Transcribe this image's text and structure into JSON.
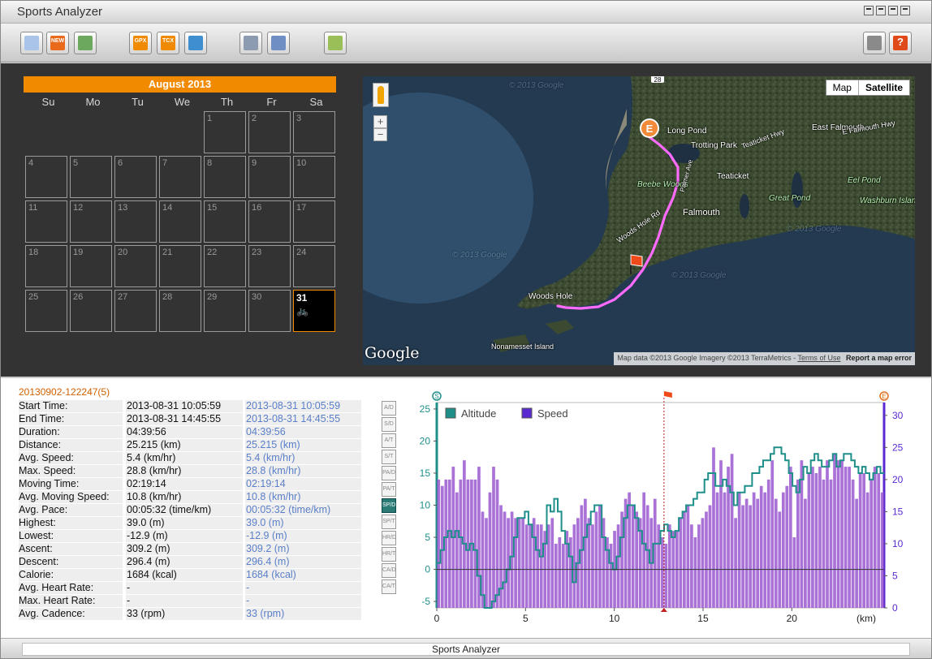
{
  "window": {
    "title": "Sports Analyzer"
  },
  "toolbar": {
    "buttons": [
      {
        "name": "import-button",
        "color": "#a9c4e8",
        "text": ""
      },
      {
        "name": "new-button",
        "color": "#e96a1a",
        "text": "NEW"
      },
      {
        "name": "list-view-button",
        "color": "#6ca85e",
        "text": ""
      },
      {
        "name": "export-gpx-button",
        "color": "#f08a00",
        "text": "GPX"
      },
      {
        "name": "export-tcx-button",
        "color": "#f08a00",
        "text": "TCX"
      },
      {
        "name": "google-earth-button",
        "color": "#3f8fd0",
        "text": ""
      },
      {
        "name": "print-button",
        "color": "#8c9bb0",
        "text": ""
      },
      {
        "name": "database-button",
        "color": "#6f8fc4",
        "text": ""
      },
      {
        "name": "device-sync-button",
        "color": "#9bbf58",
        "text": ""
      },
      {
        "name": "settings-button",
        "color": "#8a8a8a",
        "text": ""
      },
      {
        "name": "help-button",
        "color": "#e04a1a",
        "text": "?"
      }
    ]
  },
  "calendar": {
    "month_label": "August 2013",
    "weekdays": [
      "Su",
      "Mo",
      "Tu",
      "We",
      "Th",
      "Fr",
      "Sa"
    ],
    "first_weekday_index": 4,
    "days": [
      "1",
      "2",
      "3",
      "4",
      "5",
      "6",
      "7",
      "8",
      "9",
      "10",
      "11",
      "12",
      "13",
      "14",
      "15",
      "16",
      "17",
      "18",
      "19",
      "20",
      "21",
      "22",
      "23",
      "24",
      "25",
      "26",
      "27",
      "28",
      "29",
      "30",
      "31"
    ],
    "selected_day": "31",
    "activity_icon": "bicycle-icon"
  },
  "map": {
    "map_type_options": [
      "Map",
      "Satellite"
    ],
    "selected_map_type": "Satellite",
    "labels": [
      "Long Pond",
      "East Falmouth",
      "E Falmouth Hwy",
      "Trotting Park",
      "Teaticket Hwy",
      "Teaticket",
      "Eel Pond",
      "Beebe Woods",
      "Washburn Island",
      "Great Pond",
      "Falmouth",
      "Woods Hole Rd",
      "Woods Hole",
      "Nonamesset Island",
      "Palmer Ave"
    ],
    "route_shield": "28",
    "watermark": "© 2013 Google",
    "logo": "Google",
    "attribution": "Map data ©2013 Google Imagery ©2013 TerraMetrics -",
    "terms_link": "Terms of Use",
    "report_link": "Report a map error",
    "end_marker": "E"
  },
  "session": {
    "id": "20130902-122247(5)",
    "stats": [
      {
        "label": "Start Time:",
        "value": "2013-08-31 10:05:59",
        "compare": "2013-08-31 10:05:59"
      },
      {
        "label": "End Time:",
        "value": "2013-08-31 14:45:55",
        "compare": "2013-08-31 14:45:55"
      },
      {
        "label": "Duration:",
        "value": "04:39:56",
        "compare": "04:39:56"
      },
      {
        "label": "Distance:",
        "value": "25.215 (km)",
        "compare": "25.215 (km)"
      },
      {
        "label": "Avg. Speed:",
        "value": "5.4 (km/hr)",
        "compare": "5.4 (km/hr)"
      },
      {
        "label": "Max. Speed:",
        "value": "28.8 (km/hr)",
        "compare": "28.8 (km/hr)"
      },
      {
        "label": "Moving Time:",
        "value": "02:19:14",
        "compare": "02:19:14"
      },
      {
        "label": "Avg. Moving Speed:",
        "value": "10.8 (km/hr)",
        "compare": "10.8 (km/hr)"
      },
      {
        "label": "Avg. Pace:",
        "value": "00:05:32 (time/km)",
        "compare": "00:05:32 (time/km)"
      },
      {
        "label": "Highest:",
        "value": "39.0 (m)",
        "compare": "39.0 (m)"
      },
      {
        "label": "Lowest:",
        "value": "-12.9 (m)",
        "compare": "-12.9 (m)"
      },
      {
        "label": "Ascent:",
        "value": "309.2 (m)",
        "compare": "309.2 (m)"
      },
      {
        "label": "Descent:",
        "value": "296.4 (m)",
        "compare": "296.4 (m)"
      },
      {
        "label": "Calorie:",
        "value": "1684 (kcal)",
        "compare": "1684 (kcal)"
      },
      {
        "label": "Avg. Heart Rate:",
        "value": "-",
        "compare": "-"
      },
      {
        "label": "Max. Heart Rate:",
        "value": "-",
        "compare": "-"
      },
      {
        "label": "Avg. Cadence:",
        "value": "33 (rpm)",
        "compare": "33 (rpm)"
      }
    ],
    "chart_options": [
      {
        "code": "A/D",
        "on": false
      },
      {
        "code": "S/D",
        "on": false
      },
      {
        "code": "A/T",
        "on": false
      },
      {
        "code": "S/T",
        "on": false
      },
      {
        "code": "PA/D",
        "on": false
      },
      {
        "code": "PA/T",
        "on": false
      },
      {
        "code": "SP/D",
        "on": true
      },
      {
        "code": "SP/T",
        "on": false
      },
      {
        "code": "HR/D",
        "on": false
      },
      {
        "code": "HR/T",
        "on": false
      },
      {
        "code": "CA/D",
        "on": false
      },
      {
        "code": "CA/T",
        "on": false
      }
    ]
  },
  "chart_data": {
    "type": "bar",
    "xlabel": "(km)",
    "xlim": [
      0,
      25.2
    ],
    "xticks": [
      0,
      5,
      10,
      15,
      20
    ],
    "left_axis": {
      "ylim": [
        -6,
        26
      ],
      "ticks": [
        -5,
        0,
        5,
        10,
        15,
        20,
        25
      ]
    },
    "right_axis": {
      "ylim": [
        0,
        32
      ],
      "ticks": [
        0,
        5,
        10,
        15,
        20,
        25,
        30
      ]
    },
    "legend": [
      "Altitude",
      "Speed"
    ],
    "series": [
      {
        "name": "Speed",
        "axis": "right",
        "color": "#9b59d0",
        "values": [
          20,
          19,
          20,
          20,
          22,
          18,
          20,
          23,
          20,
          20,
          20,
          22,
          15,
          14,
          18,
          22,
          20,
          16,
          15,
          14,
          15,
          14,
          14,
          14,
          13,
          13,
          14,
          13,
          13,
          12,
          13,
          14,
          10,
          11,
          10,
          12,
          11,
          13,
          14,
          16,
          17,
          14,
          13,
          15,
          16,
          14,
          11,
          10,
          12,
          13,
          15,
          17,
          18,
          16,
          15,
          14,
          18,
          16,
          14,
          17,
          13,
          11,
          10,
          13,
          12,
          12,
          14,
          15,
          16,
          13,
          11,
          13,
          14,
          15,
          16,
          25,
          18,
          23,
          18,
          22,
          24,
          14,
          18,
          16,
          17,
          16,
          18,
          17,
          19,
          18,
          20,
          23,
          17,
          15,
          18,
          19,
          22,
          11,
          20,
          23,
          17,
          21,
          22,
          21,
          22,
          20,
          23,
          20,
          24,
          23,
          23,
          22,
          22,
          20,
          17,
          21,
          21,
          18,
          20,
          22,
          21,
          18
        ]
      },
      {
        "name": "Altitude",
        "axis": "left",
        "color": "#1f8f8a",
        "values": [
          1,
          3,
          5,
          6,
          5,
          6,
          5,
          4,
          3,
          4,
          3,
          -1,
          -4,
          -6,
          -6,
          -5,
          -4,
          -3,
          -2,
          0,
          2,
          5,
          8,
          8,
          9,
          7,
          5,
          3,
          2,
          4,
          10,
          9,
          11,
          9,
          6,
          4,
          2,
          -2,
          1,
          3,
          5,
          7,
          9,
          10,
          10,
          5,
          3,
          1,
          0,
          2,
          5,
          8,
          10,
          10,
          8,
          6,
          4,
          3,
          1,
          4,
          4,
          6,
          7,
          6,
          5,
          6,
          8,
          9,
          10,
          10,
          11,
          12,
          12,
          14,
          15,
          15,
          13,
          13,
          14,
          13,
          12,
          10,
          12,
          12,
          13,
          13,
          15,
          15,
          16,
          17,
          17,
          18,
          19,
          19,
          18,
          17,
          15,
          13,
          12,
          14,
          16,
          15,
          17,
          18,
          17,
          16,
          16,
          17,
          18,
          16,
          17,
          18,
          18,
          17,
          16,
          15,
          16,
          15,
          14,
          15,
          16,
          15
        ]
      }
    ],
    "markers": [
      {
        "label": "S",
        "x": 0
      },
      {
        "label": "flag",
        "x": 12.8
      },
      {
        "label": "E",
        "x": 25.2
      }
    ]
  },
  "status": {
    "text": "Sports Analyzer"
  }
}
